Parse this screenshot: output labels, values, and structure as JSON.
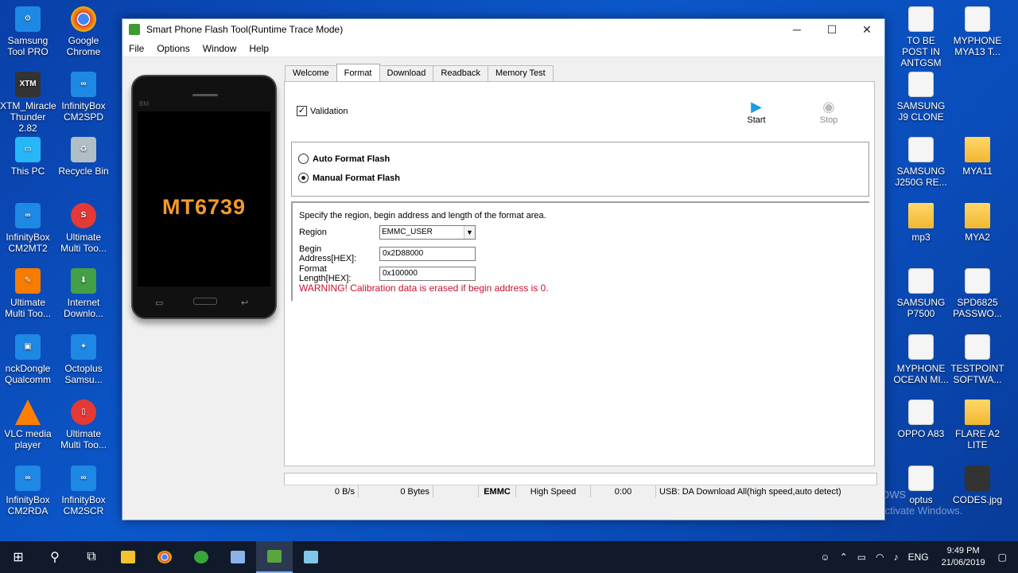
{
  "desktop": {
    "left_icons": [
      {
        "label": "Samsung Tool PRO",
        "x": 0
      },
      {
        "label": "Google Chrome",
        "x": 1
      }
    ],
    "icons": {
      "samsung_tool": "Samsung Tool PRO",
      "google_chrome": "Google Chrome",
      "xtm": "XTM_Miracle Thunder 2.82",
      "infinitybox_cm2spd": "InfinityBox CM2SPD",
      "this_pc": "This PC",
      "recycle_bin": "Recycle Bin",
      "infinitybox_cm2mt2": "InfinityBox CM2MT2",
      "ultimate_multi_1": "Ultimate Multi Too...",
      "ultimate_multi_2": "Ultimate Multi Too...",
      "internet_download": "Internet Downlo...",
      "nckdongle": "nckDongle Qualcomm",
      "octoplus": "Octoplus Samsu...",
      "vlc": "VLC media player",
      "ultimate_multi_3": "Ultimate Multi Too...",
      "infinitybox_cm2rda": "InfinityBox CM2RDA",
      "infinitybox_cm2scr": "InfinityBox CM2SCR",
      "to_be_post": "TO BE POST IN ANTGSM",
      "myphone_mya13": "MYPHONE MYA13 T...",
      "samsung_j9": "SAMSUNG J9 CLONE",
      "samsung_j250g": "SAMSUNG J250G RE...",
      "mya11": "MYA11",
      "mp3": "mp3",
      "mya2": "MYA2",
      "samsung_p7500": "SAMSUNG P7500",
      "spd6825": "SPD6825 PASSWO...",
      "myphone_ocean": "MYPHONE OCEAN MI...",
      "testpoint": "TESTPOINT SOFTWA...",
      "oppo_a83": "OPPO A83",
      "flare_a2": "FLARE A2 LITE",
      "optus": "optus",
      "codes": "CODES.jpg"
    }
  },
  "window": {
    "title": "Smart Phone Flash Tool(Runtime Trace Mode)",
    "menu": [
      "File",
      "Options",
      "Window",
      "Help"
    ],
    "phone_chip": "MT6739",
    "tabs": [
      "Welcome",
      "Format",
      "Download",
      "Readback",
      "Memory Test"
    ],
    "active_tab": "Format",
    "format": {
      "validation_label": "Validation",
      "validation_checked": true,
      "start_label": "Start",
      "stop_label": "Stop",
      "auto_format_label": "Auto Format Flash",
      "manual_format_label": "Manual Format Flash",
      "selected_mode": "Manual Format Flash",
      "area_description": "Specify the region, begin address and length of the format area.",
      "region_label": "Region",
      "region_value": "EMMC_USER",
      "begin_address_label": "Begin Address[HEX]:",
      "begin_address_value": "0x2D88000",
      "format_length_label": "Format Length[HEX]:",
      "format_length_value": "0x100000",
      "warning": "WARNING! Calibration data is erased if begin address is 0."
    },
    "status": {
      "speed": "0 B/s",
      "bytes": "0 Bytes",
      "storage": "EMMC",
      "mode": "High Speed",
      "time": "0:00",
      "usb": "USB: DA Download All(high speed,auto detect)"
    }
  },
  "watermark": {
    "line1": "Activate Windows",
    "line2": "Go to Settings to activate Windows."
  },
  "taskbar": {
    "language": "ENG",
    "time": "9:49 PM",
    "date": "21/06/2019"
  },
  "colors": {
    "warning": "#c8102e",
    "start_icon": "#1e9be8",
    "chip_text": "#f39a2c"
  }
}
